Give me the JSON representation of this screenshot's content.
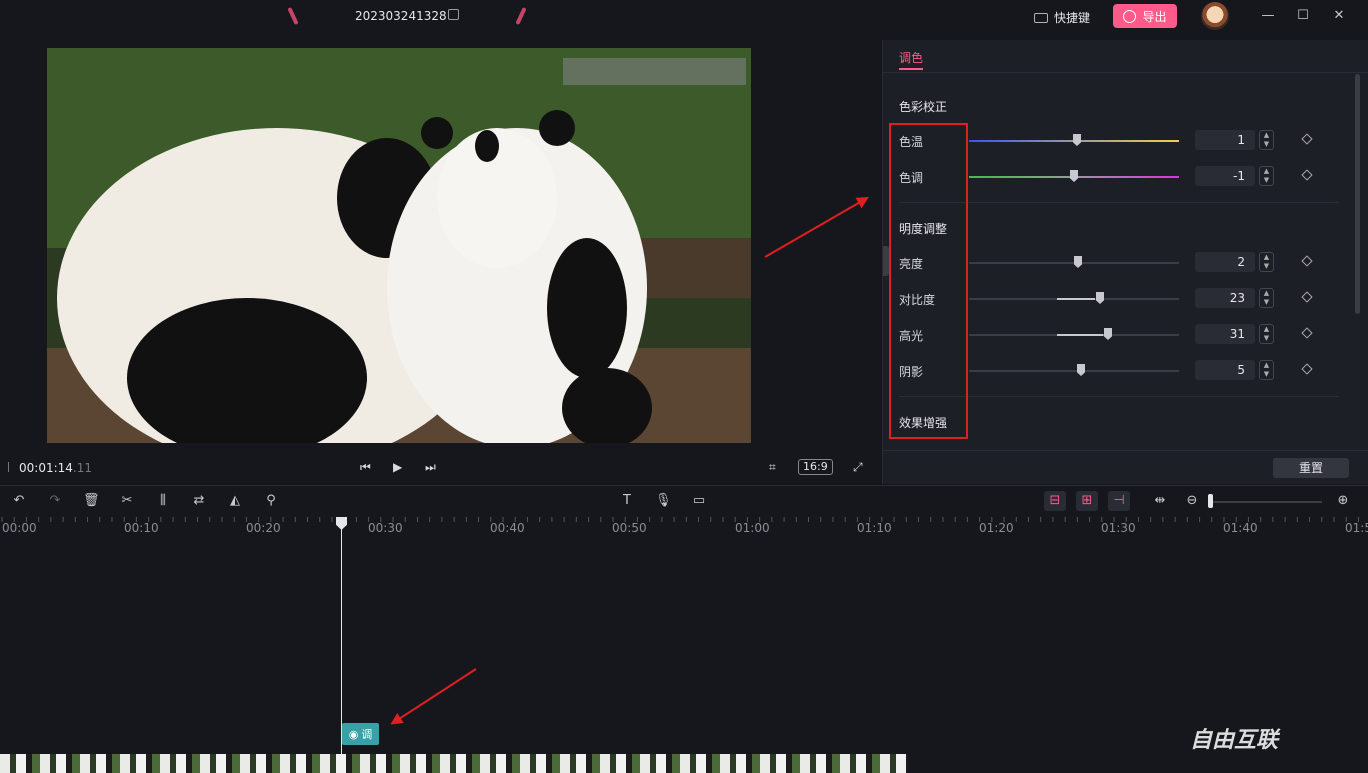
{
  "titlebar": {
    "project_name": "202303241328",
    "shortcut_label": "快捷键",
    "export_label": "导出"
  },
  "player": {
    "timecode": "00:01:14",
    "timecode_frames": ".11",
    "aspect_ratio": "16:9"
  },
  "panel": {
    "tab": "调色",
    "sections": {
      "color_correction": "色彩校正",
      "brightness": "明度调整",
      "enhance": "效果增强"
    },
    "rows": [
      {
        "label": "色温",
        "value": "1"
      },
      {
        "label": "色调",
        "value": "-1"
      },
      {
        "label": "亮度",
        "value": "2"
      },
      {
        "label": "对比度",
        "value": "23"
      },
      {
        "label": "高光",
        "value": "31"
      },
      {
        "label": "阴影",
        "value": "5"
      }
    ],
    "reset_label": "重置"
  },
  "ruler": [
    "00:00",
    "00:10",
    "00:20",
    "00:30",
    "00:40",
    "00:50",
    "01:00",
    "01:10",
    "01:20",
    "01:30",
    "01:40",
    "01:5"
  ],
  "timeline": {
    "adjust_clip_label": "调"
  },
  "watermark": "自由互联",
  "colors": {
    "accent": "#ff5a8a",
    "clip": "#3aa0a8",
    "annotation": "#e02020"
  }
}
